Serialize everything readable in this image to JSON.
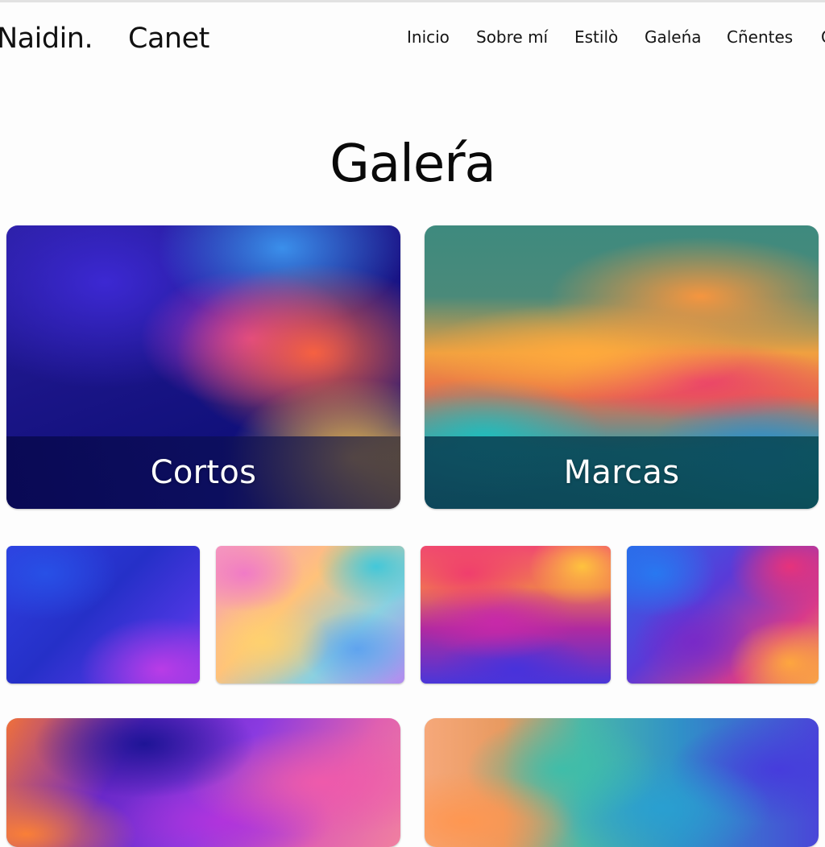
{
  "brand": {
    "first": "Naidin.",
    "second": "Canet"
  },
  "nav": {
    "items": [
      {
        "label": "Inicio"
      },
      {
        "label": "Sobre mí"
      },
      {
        "label": "Estilò"
      },
      {
        "label": "Galeńa"
      },
      {
        "label": "Cñentes"
      },
      {
        "label": "C"
      }
    ]
  },
  "page": {
    "title": "Galeŕa"
  },
  "gallery": {
    "featured": [
      {
        "label": "Cortos"
      },
      {
        "label": "Marcas"
      }
    ]
  },
  "colors": {
    "background": "#fdfdfd",
    "text": "#111111",
    "caption_text": "#ffffff"
  }
}
